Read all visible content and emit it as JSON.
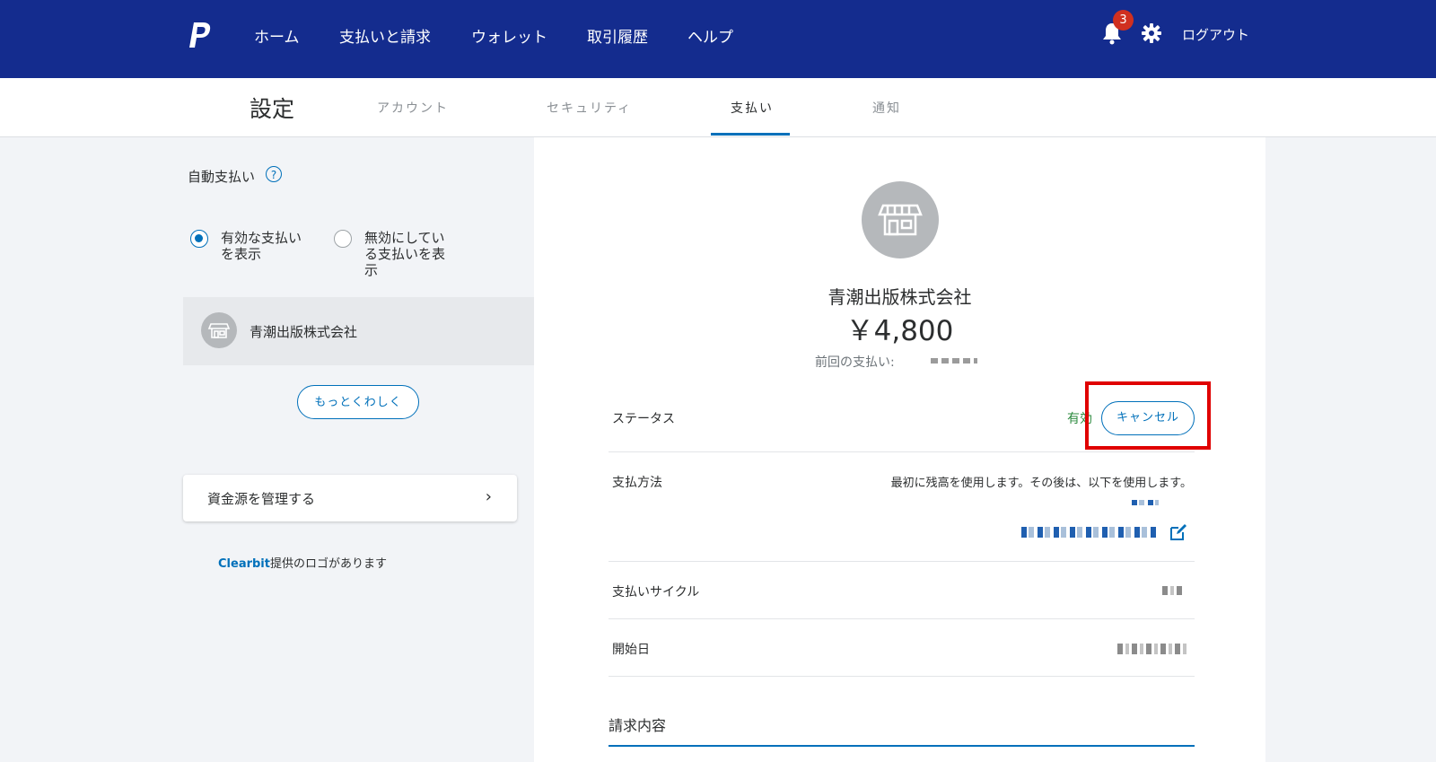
{
  "nav": {
    "logo": "paypal-logo-icon",
    "items": [
      "ホーム",
      "支払いと請求",
      "ウォレット",
      "取引履歴",
      "ヘルプ"
    ],
    "notification_count": "3",
    "logout": "ログアウト"
  },
  "settings": {
    "title": "設定",
    "tabs": [
      "アカウント",
      "セキュリティ",
      "支払い",
      "通知"
    ],
    "active_tab": "支払い"
  },
  "sidebar": {
    "section_label": "自動支払い",
    "help": "?",
    "radio_active_line1": "有効な支払い",
    "radio_active_line2": "を表示",
    "radio_inactive_line1": "無効にしてい",
    "radio_inactive_line2": "る支払いを表",
    "radio_inactive_line3": "示",
    "merchant": "青潮出版株式会社",
    "more_button": "もっとくわしく",
    "manage_funds": "資金源を管理する",
    "chevron": "›",
    "clearbit_link": "Clearbit",
    "clearbit_text": "提供のロゴがあります"
  },
  "detail": {
    "merchant_name": "青潮出版株式会社",
    "amount": "￥4,800",
    "last_payment_label": "前回の支払い:",
    "status_label": "ステータス",
    "status_value": "有効",
    "cancel_button": "キャンセル",
    "payment_method_label": "支払方法",
    "payment_method_desc": "最初に残高を使用します。その後は、以下を使用します。",
    "cycle_label": "支払いサイクル",
    "start_date_label": "開始日",
    "billing_section": "請求内容"
  },
  "colors": {
    "nav_bg": "#142c8e",
    "accent": "#0070ba",
    "status_green": "#2b8a3e",
    "highlight_red": "#e00000"
  }
}
